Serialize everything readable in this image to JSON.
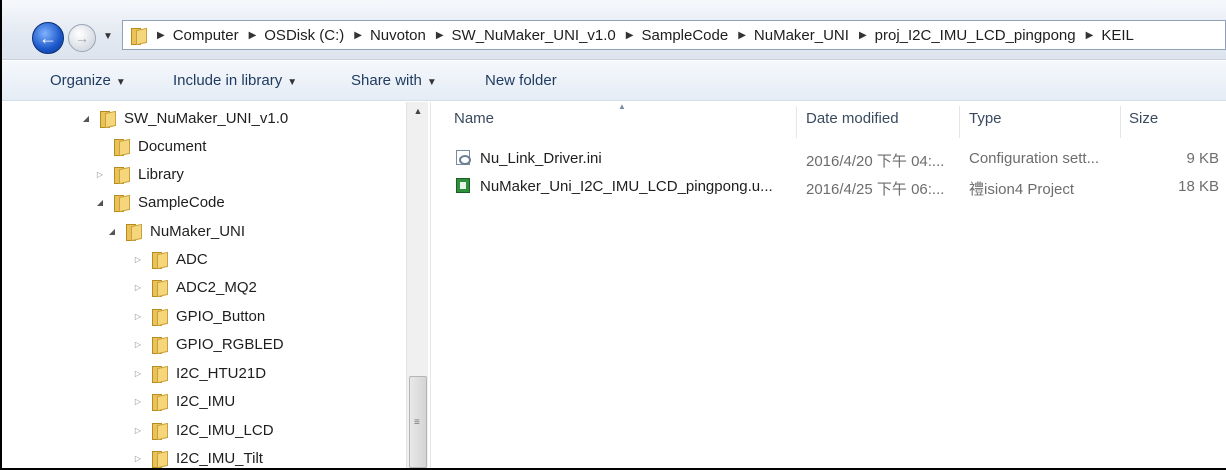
{
  "address_bar": {
    "crumbs": [
      "Computer",
      "OSDisk (C:)",
      "Nuvoton",
      "SW_NuMaker_UNI_v1.0",
      "SampleCode",
      "NuMaker_UNI",
      "proj_I2C_IMU_LCD_pingpong",
      "KEIL"
    ]
  },
  "toolbar": {
    "organize": "Organize",
    "include_in_library": "Include in library",
    "share_with": "Share with",
    "new_folder": "New folder"
  },
  "tree": [
    {
      "label": "SW_NuMaker_UNI_v1.0"
    },
    {
      "label": "Document"
    },
    {
      "label": "Library"
    },
    {
      "label": "SampleCode"
    },
    {
      "label": "NuMaker_UNI"
    },
    {
      "label": "ADC"
    },
    {
      "label": "ADC2_MQ2"
    },
    {
      "label": "GPIO_Button"
    },
    {
      "label": "GPIO_RGBLED"
    },
    {
      "label": "I2C_HTU21D"
    },
    {
      "label": "I2C_IMU"
    },
    {
      "label": "I2C_IMU_LCD"
    },
    {
      "label": "I2C_IMU_Tilt"
    }
  ],
  "columns": {
    "name": "Name",
    "date_modified": "Date modified",
    "type": "Type",
    "size": "Size"
  },
  "files": [
    {
      "name": "Nu_Link_Driver.ini",
      "date": "2016/4/20 下午 04:...",
      "type": "Configuration sett...",
      "size": "9 KB",
      "icon": "ini-file-icon"
    },
    {
      "name": "NuMaker_Uni_I2C_IMU_LCD_pingpong.u...",
      "date": "2016/4/25 下午 06:...",
      "type": "禮ision4 Project",
      "size": "18 KB",
      "icon": "uvision-project-icon"
    }
  ]
}
